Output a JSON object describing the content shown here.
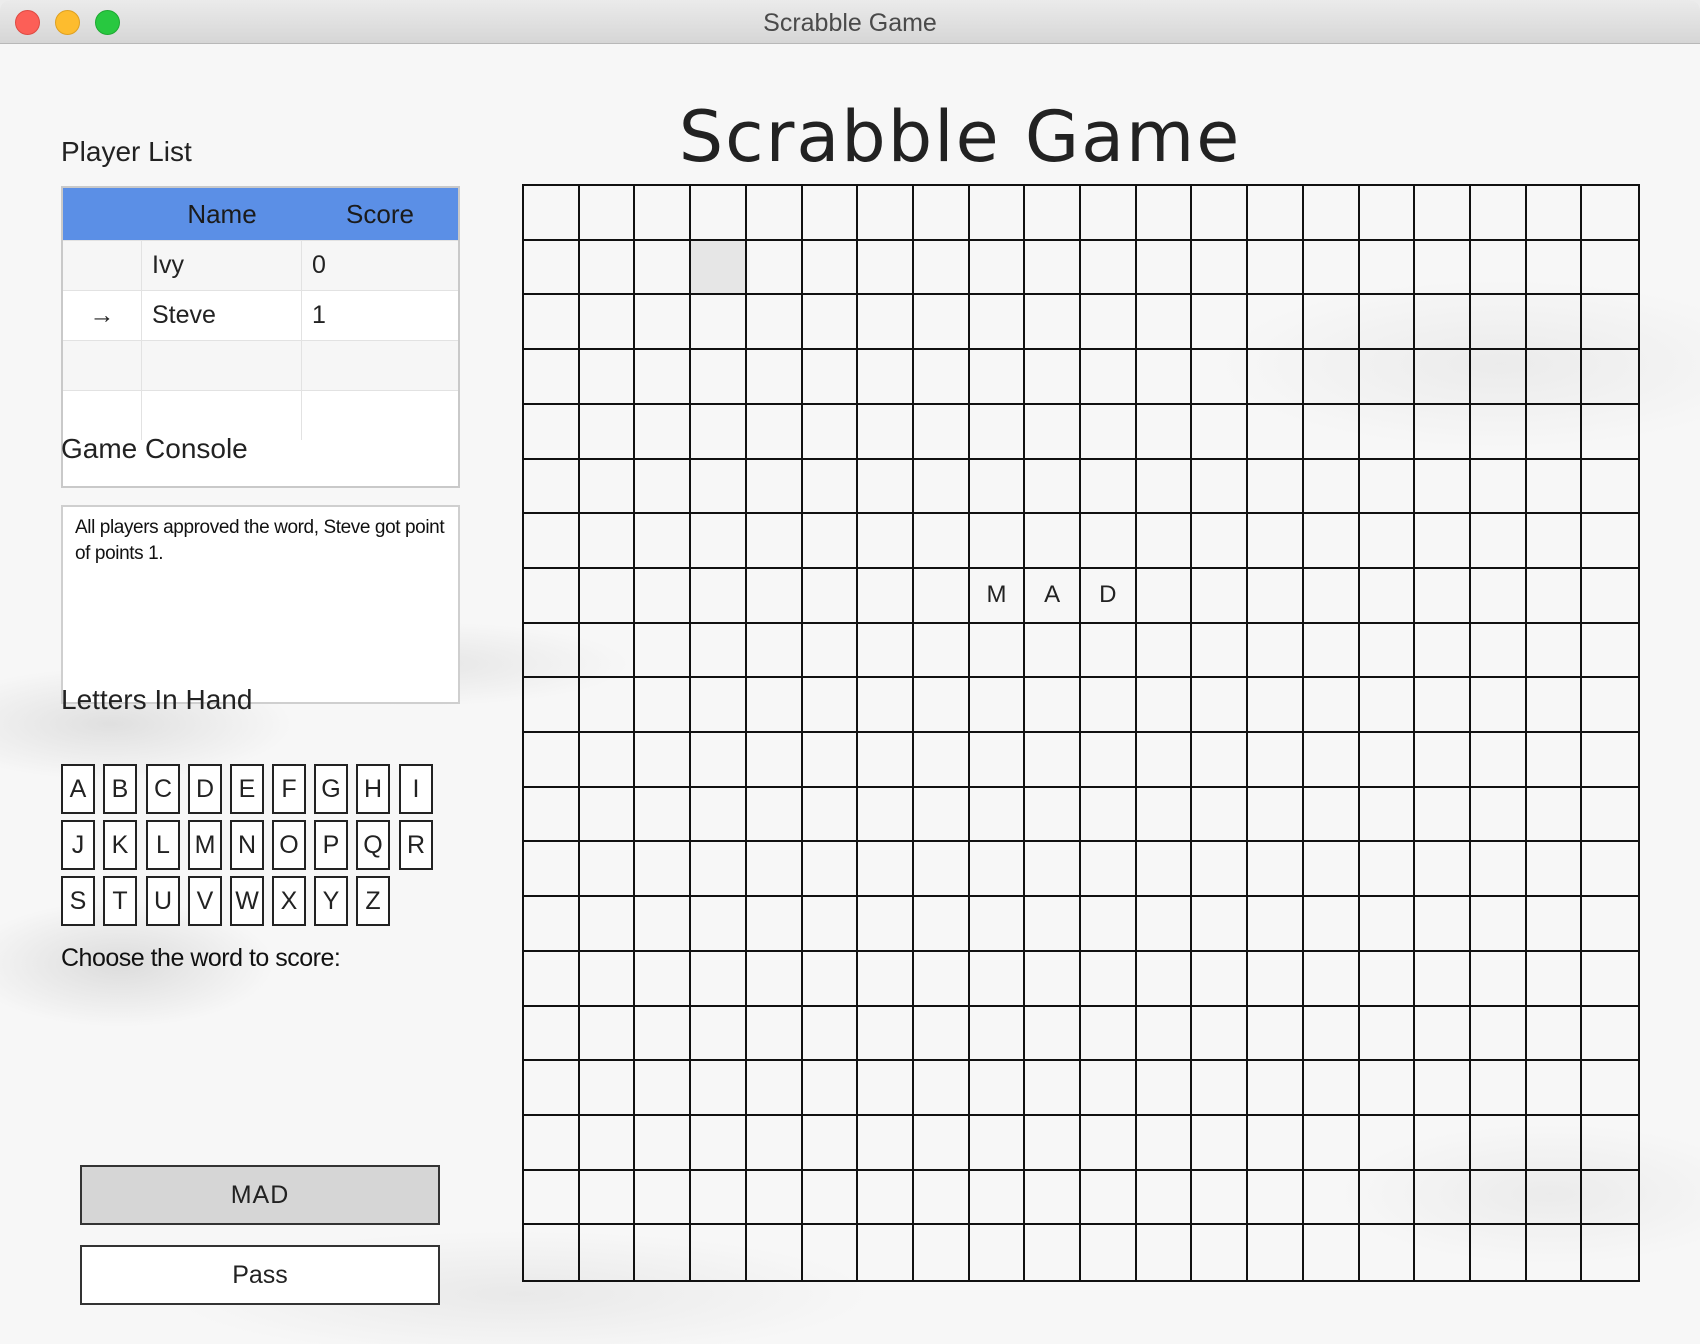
{
  "window": {
    "title": "Scrabble Game"
  },
  "header": {
    "title": "Scrabble Game"
  },
  "player_list": {
    "label": "Player List",
    "columns": [
      "",
      "Name",
      "Score"
    ],
    "rows": [
      {
        "indicator": "",
        "name": "Ivy",
        "score": "0"
      },
      {
        "indicator": "→",
        "name": "Steve",
        "score": "1"
      },
      {
        "indicator": "",
        "name": "",
        "score": ""
      },
      {
        "indicator": "",
        "name": "",
        "score": ""
      }
    ]
  },
  "console": {
    "label": "Game Console",
    "text": "All players approved the word, Steve got point of points 1."
  },
  "hand": {
    "label": "Letters In Hand",
    "letters": [
      "A",
      "B",
      "C",
      "D",
      "E",
      "F",
      "G",
      "H",
      "I",
      "J",
      "K",
      "L",
      "M",
      "N",
      "O",
      "P",
      "Q",
      "R",
      "S",
      "T",
      "U",
      "V",
      "W",
      "X",
      "Y",
      "Z"
    ]
  },
  "choose_label": "Choose the word to score:",
  "buttons": {
    "word": "MAD",
    "pass": "Pass"
  },
  "board": {
    "rows": 20,
    "cols": 20,
    "highlighted": [
      [
        1,
        3
      ]
    ],
    "tiles": [
      {
        "row": 7,
        "col": 8,
        "letter": "M"
      },
      {
        "row": 7,
        "col": 9,
        "letter": "A"
      },
      {
        "row": 7,
        "col": 10,
        "letter": "D"
      }
    ]
  }
}
